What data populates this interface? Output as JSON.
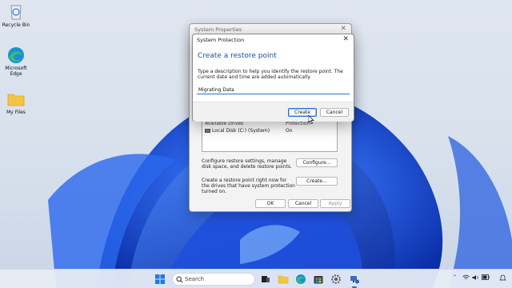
{
  "desktop": {
    "icons": [
      {
        "label": "Recycle Bin",
        "icon": "recycle-bin-icon"
      },
      {
        "label": "Microsoft Edge",
        "icon": "edge-icon"
      },
      {
        "label": "My Files",
        "icon": "folder-icon"
      }
    ]
  },
  "system_properties": {
    "title": "System Properties",
    "drives_header": {
      "col1": "Available Drives",
      "col2": "Protection"
    },
    "drives": [
      {
        "name": "Local Disk (C:) (System)",
        "protection": "On"
      }
    ],
    "configure_text": "Configure restore settings, manage disk space, and delete restore points.",
    "configure_button": "Configure...",
    "create_text": "Create a restore point right now for the drives that have system protection turned on.",
    "create_button": "Create...",
    "ok_button": "OK",
    "cancel_button": "Cancel",
    "apply_button": "Apply"
  },
  "system_protection": {
    "title": "System Protection",
    "heading": "Create a restore point",
    "description": "Type a description to help you identify the restore point. The current date and time are added automatically.",
    "input_value": "Migrating Data",
    "create_button": "Create",
    "cancel_button": "Cancel"
  },
  "taskbar": {
    "search_label": "Search",
    "apps": [
      "start-icon",
      "search-icon",
      "task-view-icon",
      "file-explorer-icon",
      "edge-icon",
      "microsoft-store-icon",
      "settings-icon",
      "system-properties-icon"
    ],
    "tray_icons": [
      "chevron-up-icon",
      "wifi-icon",
      "volume-icon",
      "battery-icon",
      "notification-icon"
    ]
  },
  "colors": {
    "accent": "#2b6fd6",
    "heading": "#1b4f9c",
    "wallpaper_blue": "#1f4fd8"
  }
}
